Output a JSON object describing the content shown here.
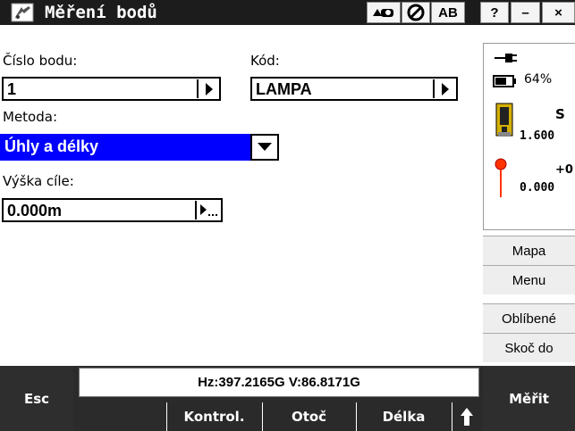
{
  "window": {
    "title": "Měření bodů",
    "toolbar_ab": "AB",
    "help": "?",
    "minimize": "–",
    "close": "×"
  },
  "form": {
    "point_label": "Číslo bodu:",
    "point_value": "1",
    "code_label": "Kód:",
    "code_value": "LAMPA",
    "method_label": "Metoda:",
    "method_value": "Úhly a délky",
    "target_height_label": "Výška cíle:",
    "target_height_value": "0.000m"
  },
  "status": {
    "battery_percent": "64%",
    "instrument_letter": "S",
    "instrument_height": "1.600",
    "target_sign": "+0",
    "target_value": "0.000"
  },
  "side_buttons": {
    "map": "Mapa",
    "menu": "Menu",
    "favorites": "Oblíbené",
    "jump": "Skoč do"
  },
  "bottom": {
    "esc": "Esc",
    "readout": "Hz:397.2165G  V:86.8171G",
    "softkey_check": "Kontrol.",
    "softkey_rotate": "Otoč",
    "softkey_length": "Délka",
    "measure": "Měřit"
  },
  "colors": {
    "title_bar": "#1c1c1c",
    "selected_field": "#0000ff",
    "bottom_bar": "#2b2b2b"
  }
}
